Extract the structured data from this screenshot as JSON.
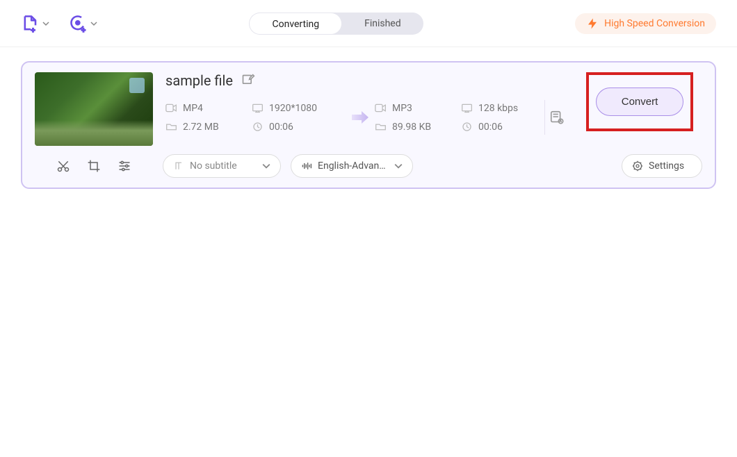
{
  "header": {
    "tabs": {
      "converting": "Converting",
      "finished": "Finished"
    },
    "speed_label": "High Speed Conversion"
  },
  "file": {
    "title": "sample file",
    "source": {
      "format": "MP4",
      "resolution": "1920*1080",
      "size": "2.72 MB",
      "duration": "00:06"
    },
    "target": {
      "format": "MP3",
      "bitrate": "128 kbps",
      "size": "89.98 KB",
      "duration": "00:06"
    },
    "convert_label": "Convert"
  },
  "tools": {
    "subtitle_label": "No subtitle",
    "audio_label": "English-Advanc...",
    "settings_label": "Settings"
  }
}
